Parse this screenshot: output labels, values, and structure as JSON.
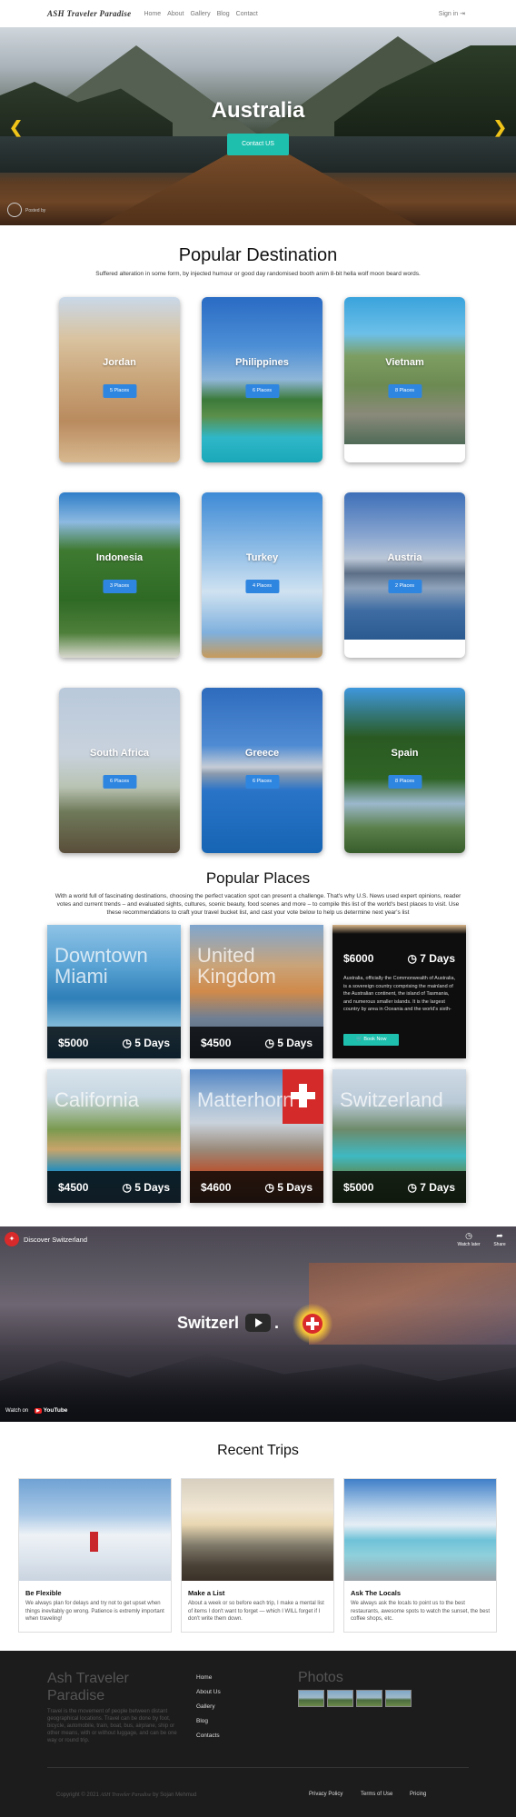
{
  "nav": {
    "brand": "ASH Traveler Paradise",
    "links": [
      "Home",
      "About",
      "Gallery",
      "Blog",
      "Contact"
    ],
    "signin": "Sign in ⇥"
  },
  "hero": {
    "title": "Australia",
    "cta": "Contact US",
    "prev_icon": "chevron-left-icon",
    "next_icon": "chevron-right-icon",
    "posted": "Posted by"
  },
  "destinations": {
    "heading": "Popular Destination",
    "subtitle": "Suffered alteration in some form, by injected humour or good day randomised booth anim 8-bit hella wolf moon beard words.",
    "items": [
      {
        "name": "Jordan",
        "badge": "5 Places"
      },
      {
        "name": "Philippines",
        "badge": "6 Places"
      },
      {
        "name": "Vietnam",
        "badge": "8 Places"
      },
      {
        "name": "Indonesia",
        "badge": "3 Places"
      },
      {
        "name": "Turkey",
        "badge": "4 Places"
      },
      {
        "name": "Austria",
        "badge": "2 Places"
      },
      {
        "name": "South Africa",
        "badge": "6 Places"
      },
      {
        "name": "Greece",
        "badge": "6 Places"
      },
      {
        "name": "Spain",
        "badge": "8 Places"
      }
    ]
  },
  "places": {
    "heading": "Popular Places",
    "subtitle": "With a world full of fascinating destinations, choosing the perfect vacation spot can present a challenge. That's why U.S. News used expert opinions, reader votes and current trends – and evaluated sights, cultures, scenic beauty, food scenes and more – to compile this list of the world's best places to visit. Use these recommendations to craft your travel bucket list, and cast your vote below to help us determine next year's list",
    "items": [
      {
        "name": "Downtown Miami",
        "price": "$5000",
        "days": "5 Days"
      },
      {
        "name": "United Kingdom",
        "price": "$4500",
        "days": "5 Days"
      },
      {
        "name": "Australia",
        "price": "$6000",
        "days": "7 Days",
        "description": "Australia, officially the Commonwealth of Australia, is a sovereign country comprising the mainland of the Australian continent, the island of Tasmania, and numerous smaller islands. It is the largest country by area in Oceania and the world's sixth-",
        "button": "Book Now"
      },
      {
        "name": "California",
        "price": "$4500",
        "days": "5 Days"
      },
      {
        "name": "Matterhorn",
        "price": "$4600",
        "days": "5 Days"
      },
      {
        "name": "Switzerland",
        "price": "$5000",
        "days": "7 Days"
      }
    ]
  },
  "video": {
    "title": "Discover Switzerland",
    "watch_later": "Watch later",
    "share": "Share",
    "overlay_text": "Switzerl",
    "overlay_end": ".",
    "watch_on": "Watch on",
    "youtube": "YouTube"
  },
  "trips": {
    "heading": "Recent Trips",
    "items": [
      {
        "title": "Be Flexible",
        "text": "We always plan for delays and try not to get upset when things inevitably go wrong. Patience is extremly important when traveling!"
      },
      {
        "title": "Make a List",
        "text": "About a week or so before each trip, I make a mental list of items I don't want to forget — which I WILL forget if I don't write them down."
      },
      {
        "title": "Ask The Locals",
        "text": "We always ask the locals to point us to the best restaurants, awesome spots to watch the sunset, the best coffee shops, etc."
      }
    ]
  },
  "footer": {
    "brand": "Ash Traveler Paradise",
    "about": "Travel is the movement of people between distant geographical locations. Travel can be done by foot, bicycle, automobile, train, boat, bus, airplane, ship or other means, with or without luggage, and can be one way or round trip.",
    "links": [
      "Home",
      "About Us",
      "Gallery",
      "Blog",
      "Contacts"
    ],
    "photos_heading": "Photos",
    "copyright": "Copyright © 2021",
    "copyright_brand": "ASH Traveler Paradise",
    "copyright_by": "by Sojan Mehmud",
    "bottom_links": [
      "Privacy Policy",
      "Terms of Use",
      "Pricing"
    ]
  },
  "colors": {
    "accent": "#1fbfae",
    "badge": "#2f86e0",
    "arrow": "#f0c419",
    "footer": "#1c1c1c"
  }
}
